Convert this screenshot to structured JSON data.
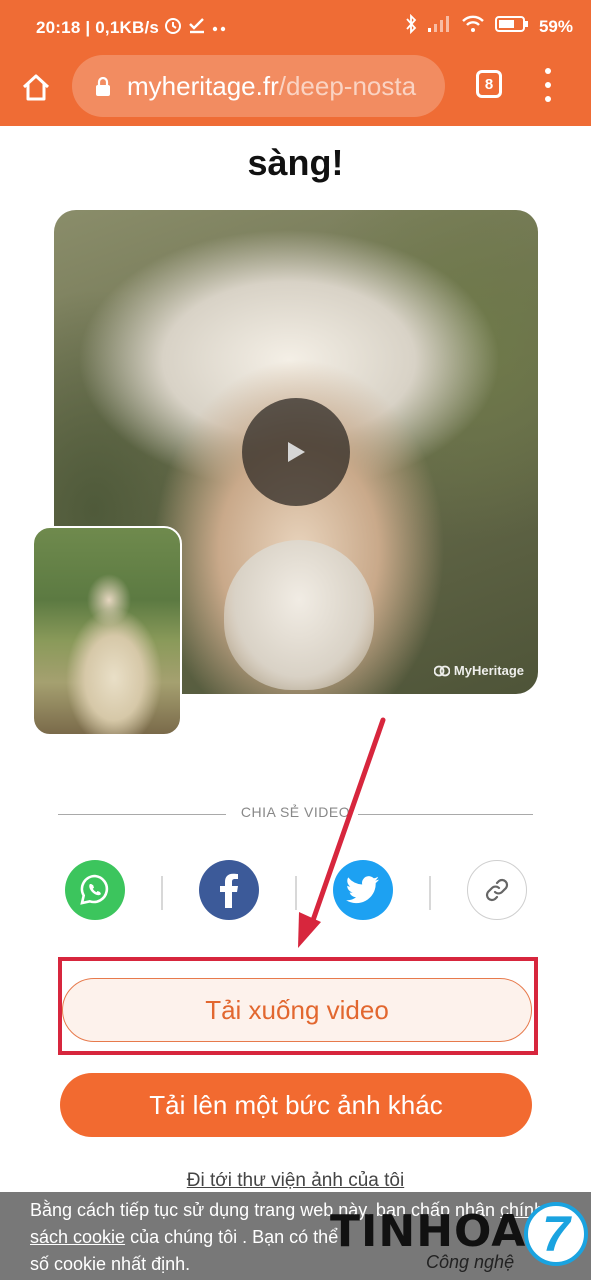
{
  "status_bar": {
    "time_speed": "20:18 | 0,1KB/s",
    "battery": "59%"
  },
  "browser": {
    "url_domain": "myheritage.fr",
    "url_path": "/deep-nosta",
    "tab_count": "8"
  },
  "page": {
    "title_line": "sàng!",
    "watermark": "MyHeritage",
    "share_label": "CHIA SẺ VIDEO",
    "download_button": "Tải xuống video",
    "upload_button": "Tải lên một bức ảnh khác",
    "gallery_link": "Đi tới thư viện ảnh của tôi"
  },
  "cookie_banner": {
    "text_1": "Bằng cách tiếp tục sử dụng trang web này, bạn chấp nhận ",
    "link_1": "chính",
    "link_2": "sách cookie",
    "text_2": " của chúng tôi . Bạn có thể ",
    "text_3": "số cookie nhất định."
  },
  "brand": {
    "name": "TINHOA",
    "badge": "7",
    "subtitle": "Công nghệ"
  },
  "colors": {
    "chrome_orange": "#ef6c35",
    "accent_orange": "#f26a30",
    "highlight_red": "#d7263d",
    "whatsapp": "#3cc55d",
    "facebook": "#3c5a99",
    "twitter": "#1da1f2"
  }
}
